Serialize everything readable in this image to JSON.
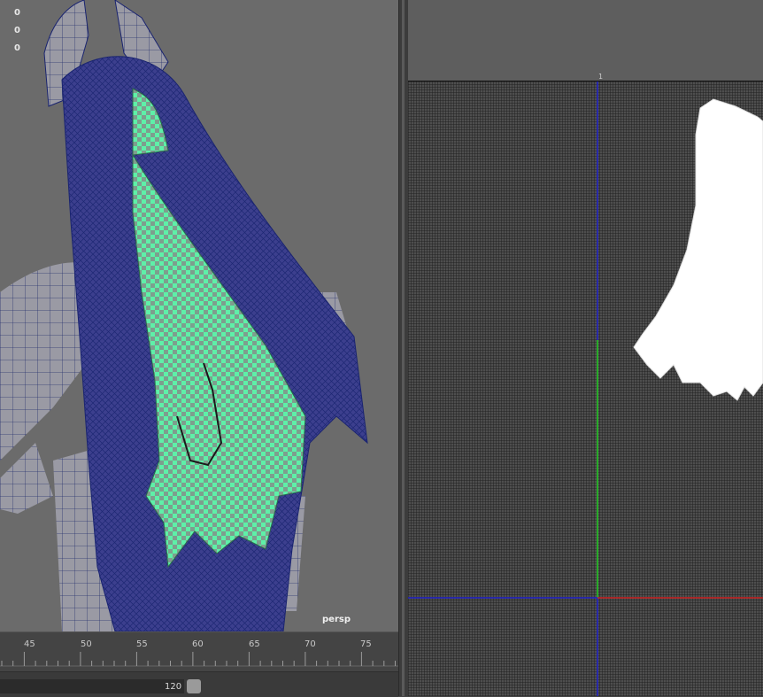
{
  "viewport": {
    "hud_values": [
      "0",
      "0",
      "0"
    ],
    "camera": "persp"
  },
  "uv_editor": {
    "tick_label": "1"
  },
  "timeline": {
    "frame_labels": [
      "45",
      "50",
      "55",
      "60",
      "65",
      "70",
      "75"
    ],
    "range_end": "120"
  },
  "colors": {
    "viewport_bg": "#6b6b6b",
    "wireframe": "#1a2470",
    "selection": "#5ef0a8",
    "uv_shell": "#ffffff",
    "axis_u": "#cc2222",
    "axis_v": "#22cc22",
    "axis_blue": "#2222cc"
  },
  "icons": {
    "range_handle": "slider-handle-icon"
  }
}
